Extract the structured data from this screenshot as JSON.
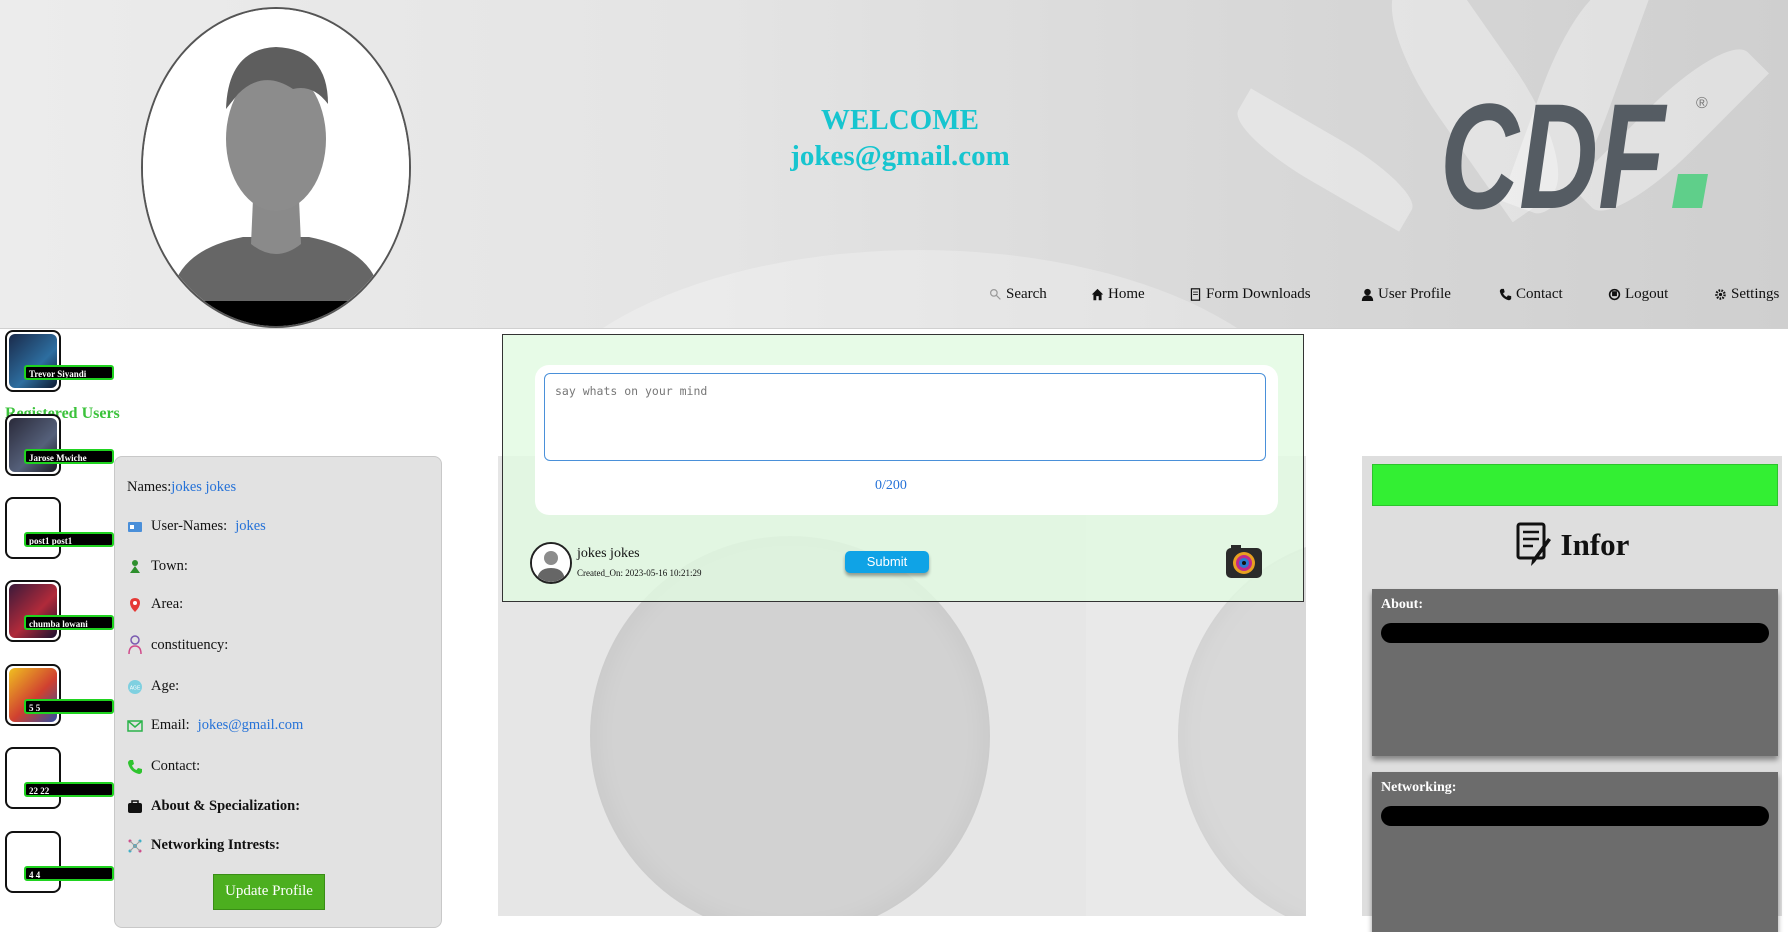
{
  "header": {
    "welcome_line": "WELCOME",
    "email": "jokes@gmail.com",
    "logo_text": "CDF",
    "logo_mark": "®"
  },
  "nav": {
    "items": [
      {
        "label": "Search",
        "icon": "search-icon"
      },
      {
        "label": "Home",
        "icon": "home-icon"
      },
      {
        "label": "Form Downloads",
        "icon": "document-icon"
      },
      {
        "label": "User Profile",
        "icon": "user-icon"
      },
      {
        "label": "Contact",
        "icon": "phone-icon"
      },
      {
        "label": "Logout",
        "icon": "logout-icon"
      },
      {
        "label": "Settings",
        "icon": "gear-icon"
      }
    ]
  },
  "users": {
    "title": "Registered Users",
    "list": [
      {
        "name": "Trevor Siyandi"
      },
      {
        "name": "Jarose Mwiche"
      },
      {
        "name": "post1 post1"
      },
      {
        "name": "chumba lowani"
      },
      {
        "name": "5 5"
      },
      {
        "name": "22 22"
      },
      {
        "name": "4 4"
      }
    ]
  },
  "profile": {
    "names_label": "Names:",
    "names_value": "jokes jokes",
    "username_label": "User-Names:",
    "username_value": "jokes",
    "town_label": "Town:",
    "area_label": "Area:",
    "constituency_label": "constituency:",
    "age_label": "Age:",
    "email_label": "Email:",
    "email_value": "jokes@gmail.com",
    "contact_label": "Contact:",
    "about_label": "About & Specialization:",
    "networking_label": "Networking Intrests:",
    "update_button": "Update Profile"
  },
  "post": {
    "placeholder": "say whats on your mind",
    "counter": "0/200",
    "author": "jokes jokes",
    "created": "Created_On: 2023-05-16 10:21:29",
    "submit_label": "Submit"
  },
  "infor": {
    "title": "Infor",
    "about_label": "About:",
    "networking_label": "Networking:"
  },
  "colors": {
    "welcome": "#17c5cf",
    "green_accent": "#33ef33",
    "link_blue": "#2572d8",
    "logo_gray": "#555c63",
    "logo_green": "#5fcf8a"
  }
}
